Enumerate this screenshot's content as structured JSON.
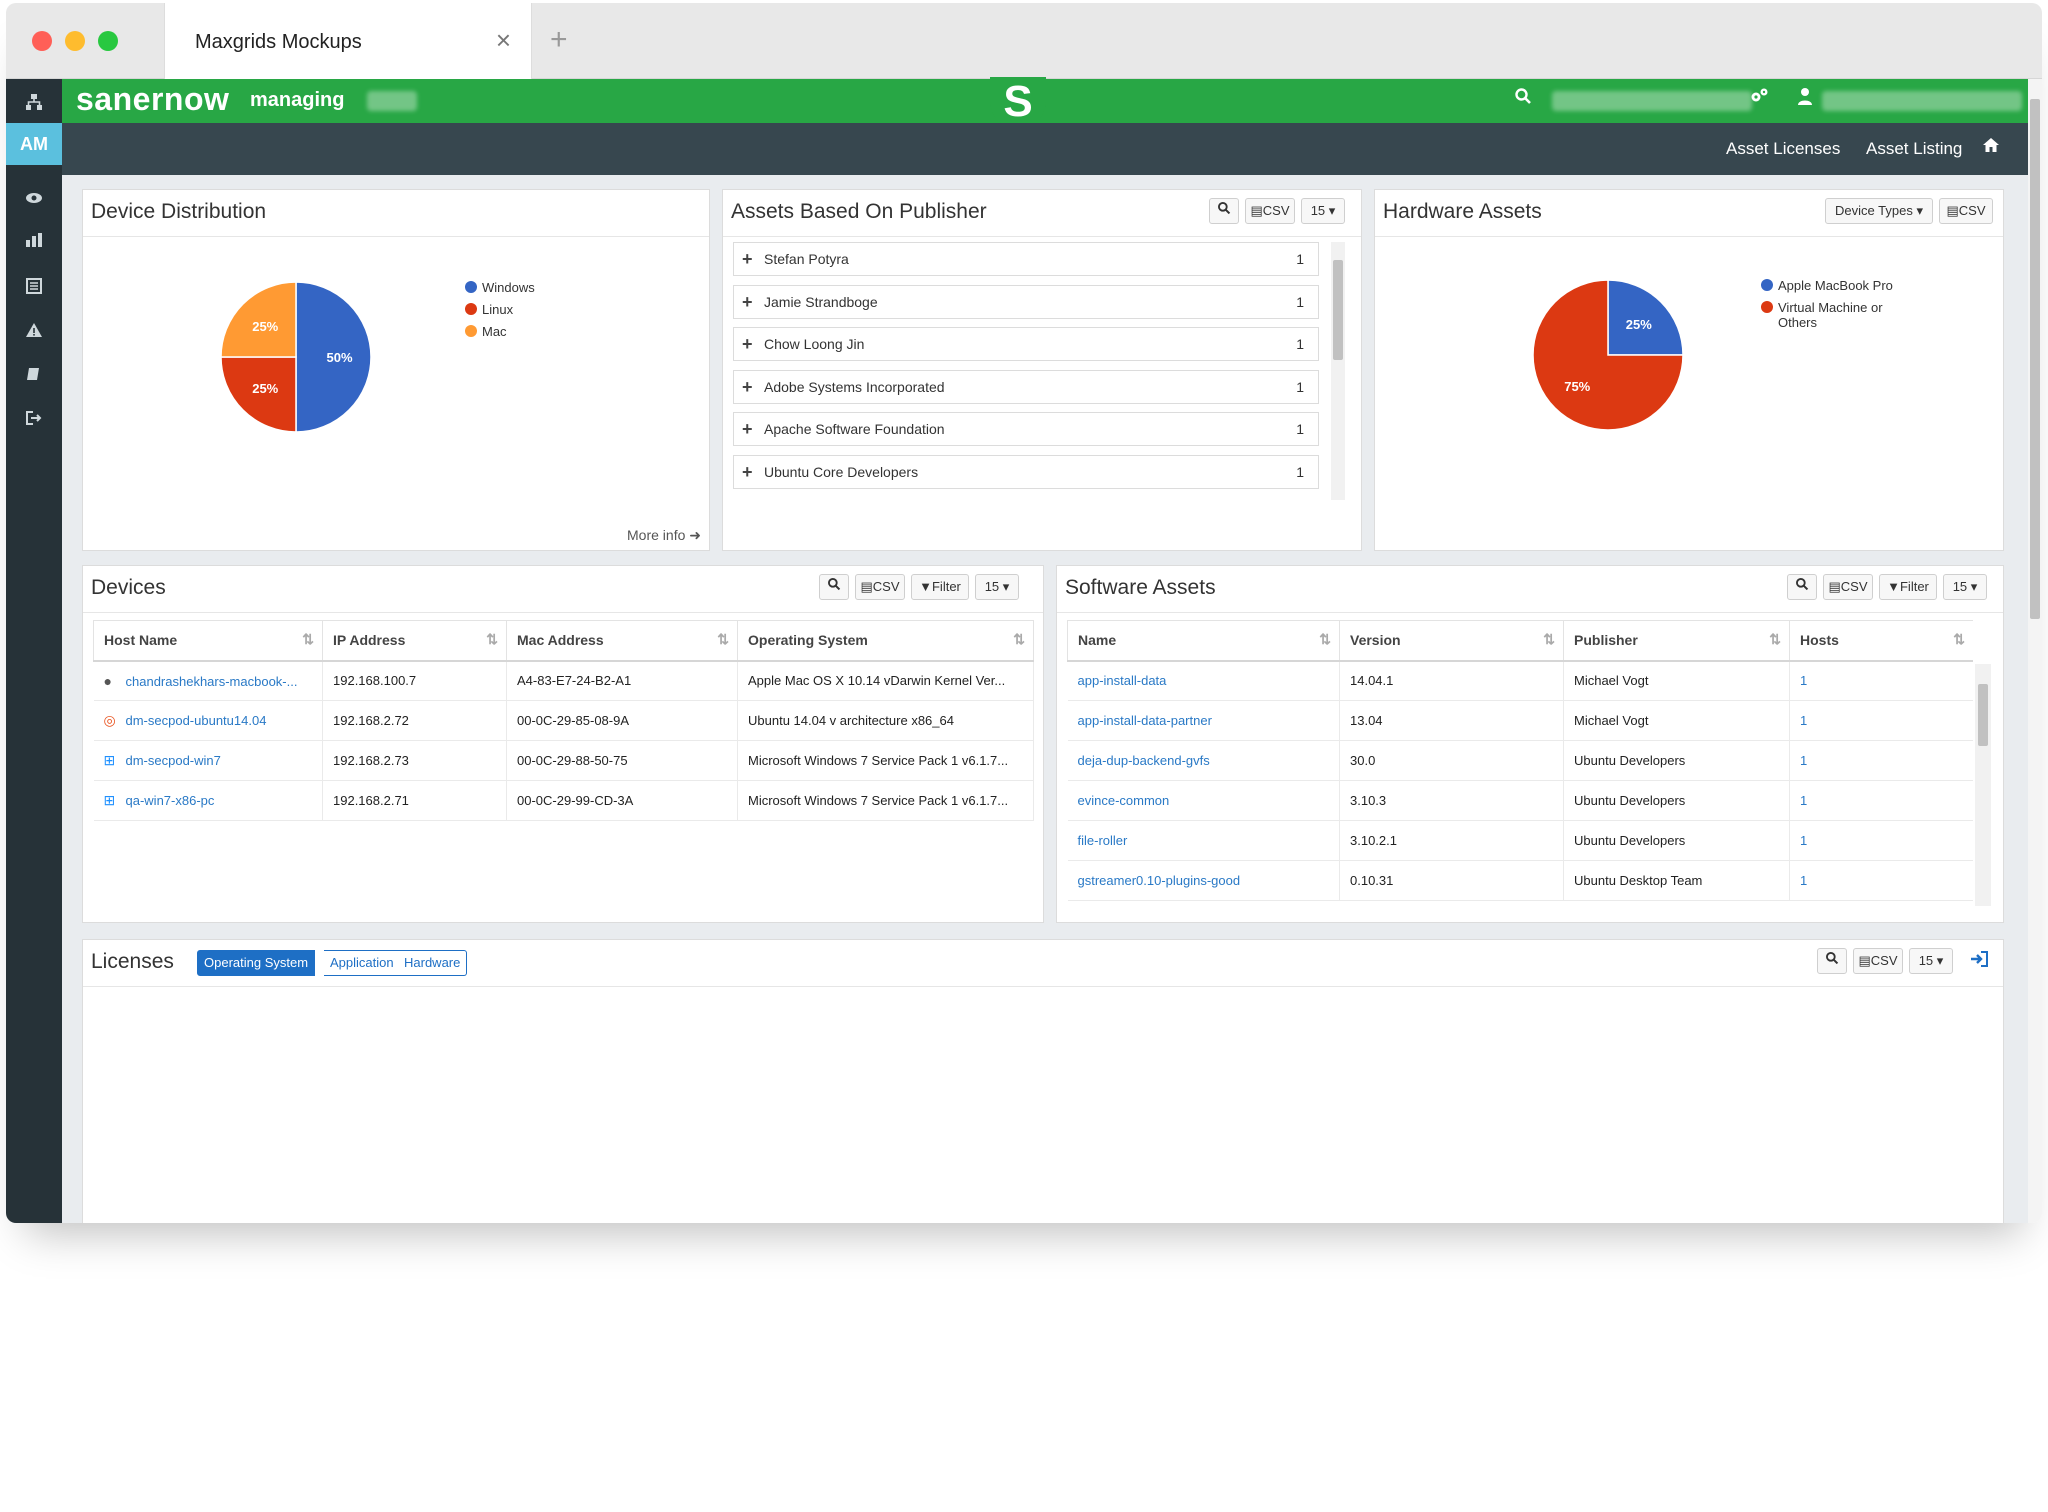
{
  "browser": {
    "tab_title": "Maxgrids Mockups",
    "close_glyph": "×",
    "newtab_glyph": "+",
    "dots": [
      "#ff5f57",
      "#febc2e",
      "#28c840"
    ]
  },
  "app": {
    "logo": "sanernow",
    "managing": "managing",
    "center_logo": "S",
    "sidebar_badge": "AM"
  },
  "subnav": {
    "asset_licenses": "Asset Licenses",
    "asset_listing": "Asset Listing"
  },
  "controls": {
    "csv": "CSV",
    "filter": "Filter",
    "page_size": "15",
    "device_types": "Device Types"
  },
  "device_distribution": {
    "title": "Device Distribution",
    "more_info": "More info",
    "legend": [
      {
        "label": "Windows",
        "color": "#3465c4"
      },
      {
        "label": "Linux",
        "color": "#dc3912"
      },
      {
        "label": "Mac",
        "color": "#ff9a33"
      }
    ],
    "chart_data": {
      "type": "pie",
      "categories": [
        "Windows",
        "Linux",
        "Mac"
      ],
      "values": [
        50,
        25,
        25
      ],
      "labels": [
        "50%",
        "25%",
        "25%"
      ]
    }
  },
  "publisher": {
    "title": "Assets Based On Publisher",
    "rows": [
      {
        "name": "Stefan Potyra",
        "count": "1"
      },
      {
        "name": "Jamie Strandboge",
        "count": "1"
      },
      {
        "name": "Chow Loong Jin",
        "count": "1"
      },
      {
        "name": "Adobe Systems Incorporated",
        "count": "1"
      },
      {
        "name": "Apache Software Foundation",
        "count": "1"
      },
      {
        "name": "Ubuntu Core Developers",
        "count": "1"
      }
    ]
  },
  "hardware": {
    "title": "Hardware Assets",
    "legend": [
      {
        "label": "Apple MacBook Pro",
        "color": "#3465c4"
      },
      {
        "label": "Virtual Machine or Others",
        "color": "#dc3912"
      }
    ],
    "chart_data": {
      "type": "pie",
      "categories": [
        "Apple MacBook Pro",
        "Virtual Machine or Others"
      ],
      "values": [
        25,
        75
      ],
      "labels": [
        "25%",
        "75%"
      ]
    }
  },
  "devices": {
    "title": "Devices",
    "columns": [
      "Host Name",
      "IP Address",
      "Mac Address",
      "Operating System"
    ],
    "rows": [
      {
        "os_icon": "apple-icon",
        "host": "chandrashekhars-macbook-...",
        "ip": "192.168.100.7",
        "mac": "A4-83-E7-24-B2-A1",
        "os": "Apple Mac OS X 10.14 vDarwin Kernel Ver..."
      },
      {
        "os_icon": "ubuntu-icon",
        "host": "dm-secpod-ubuntu14.04",
        "ip": "192.168.2.72",
        "mac": "00-0C-29-85-08-9A",
        "os": "Ubuntu 14.04 v architecture x86_64"
      },
      {
        "os_icon": "windows-icon",
        "host": "dm-secpod-win7",
        "ip": "192.168.2.73",
        "mac": "00-0C-29-88-50-75",
        "os": "Microsoft Windows 7 Service Pack 1 v6.1.7..."
      },
      {
        "os_icon": "windows-icon",
        "host": "qa-win7-x86-pc",
        "ip": "192.168.2.71",
        "mac": "00-0C-29-99-CD-3A",
        "os": "Microsoft Windows 7 Service Pack 1 v6.1.7..."
      }
    ]
  },
  "software": {
    "title": "Software Assets",
    "columns": [
      "Name",
      "Version",
      "Publisher",
      "Hosts"
    ],
    "rows": [
      {
        "name": "app-install-data",
        "version": "14.04.1",
        "publisher": "Michael Vogt",
        "hosts": "1"
      },
      {
        "name": "app-install-data-partner",
        "version": "13.04",
        "publisher": "Michael Vogt",
        "hosts": "1"
      },
      {
        "name": "deja-dup-backend-gvfs",
        "version": "30.0",
        "publisher": "Ubuntu Developers",
        "hosts": "1"
      },
      {
        "name": "evince-common",
        "version": "3.10.3",
        "publisher": "Ubuntu Developers",
        "hosts": "1"
      },
      {
        "name": "file-roller",
        "version": "3.10.2.1",
        "publisher": "Ubuntu Developers",
        "hosts": "1"
      },
      {
        "name": "gstreamer0.10-plugins-good",
        "version": "0.10.31",
        "publisher": "Ubuntu Desktop Team",
        "hosts": "1"
      }
    ]
  },
  "licenses": {
    "title": "Licenses",
    "tabs": [
      "Operating System",
      "Application",
      "Hardware"
    ]
  }
}
